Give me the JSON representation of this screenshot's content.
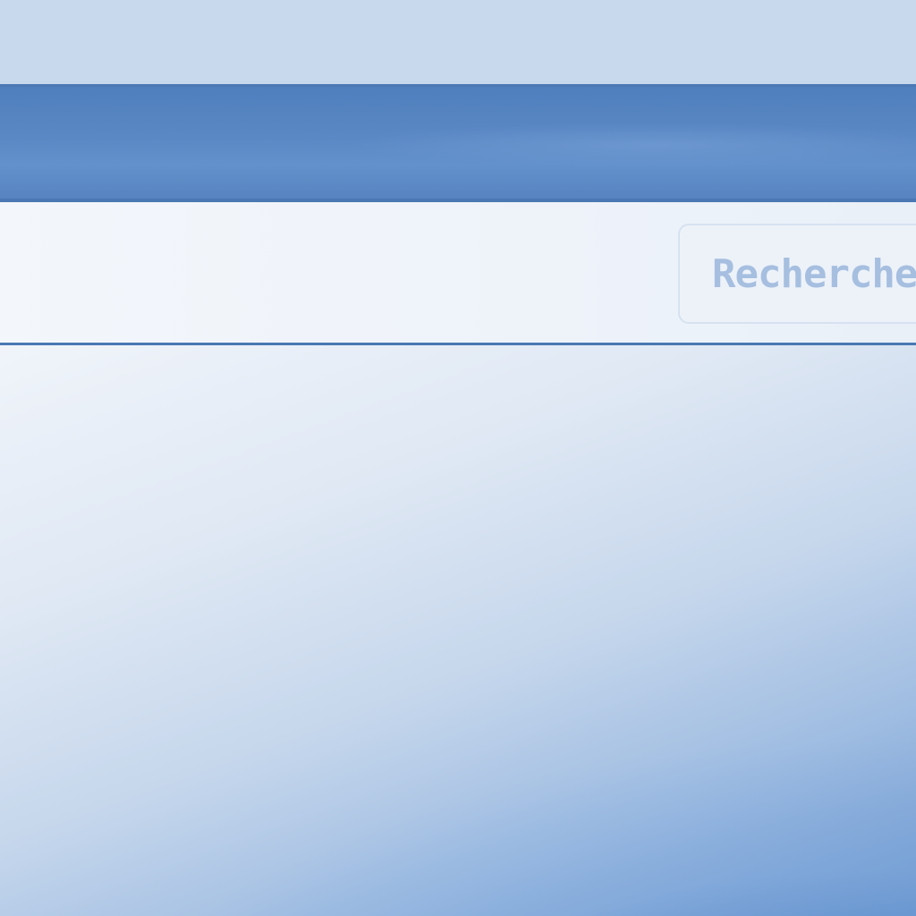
{
  "search": {
    "placeholder": "Recherche"
  },
  "colors": {
    "header": "#5a88c4",
    "background": "#c8d8ed",
    "search_text": "#a6bfe0"
  }
}
